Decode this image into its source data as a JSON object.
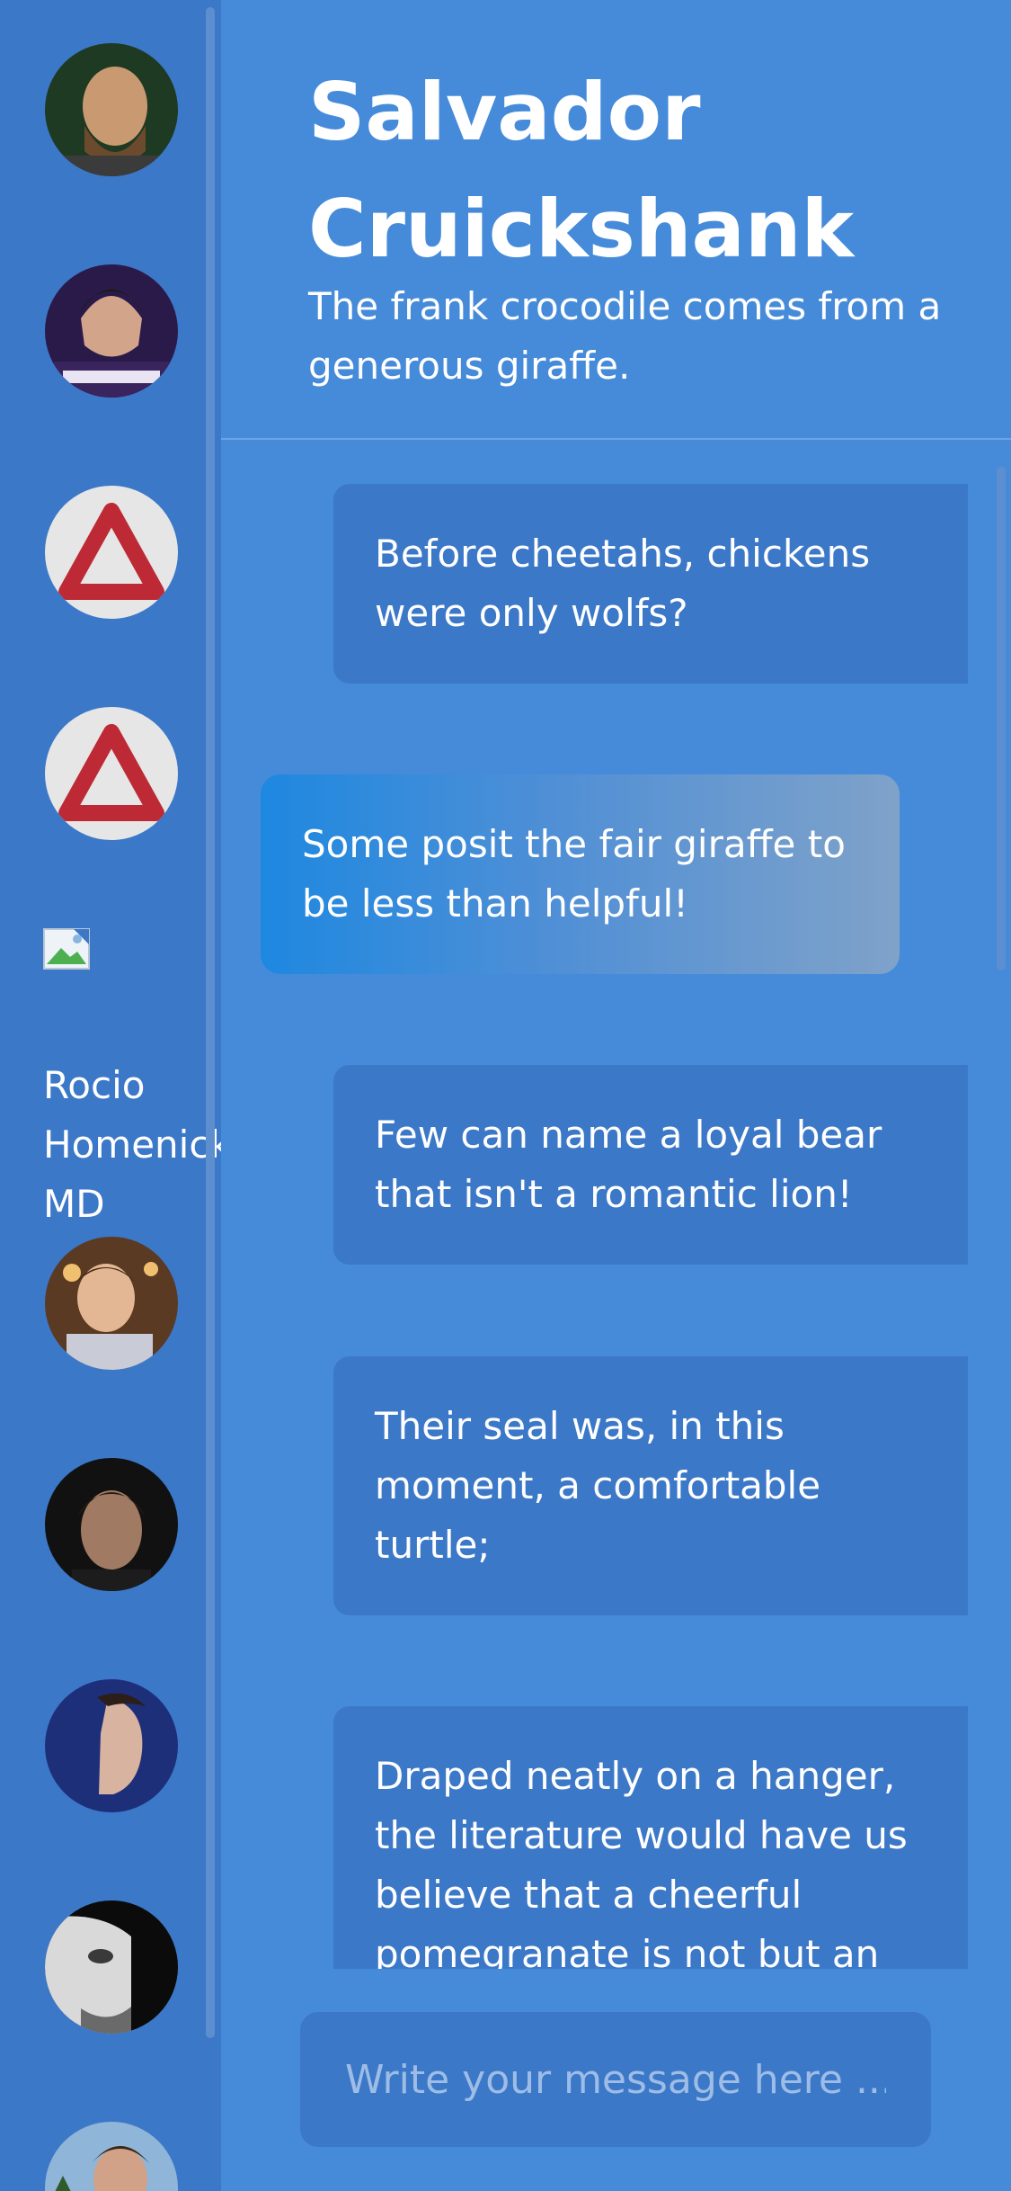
{
  "contacts": [
    {
      "name": "avatar-bald-bearded-man"
    },
    {
      "name": "avatar-young-man-hoodie"
    },
    {
      "name": "avatar-warning-triangle"
    },
    {
      "name": "avatar-warning-triangle-2"
    },
    {
      "name": "Rocio\nHomenick\nMD"
    },
    {
      "name": "avatar-smiling-man"
    },
    {
      "name": "avatar-dark-haired-man"
    },
    {
      "name": "avatar-profile-man"
    },
    {
      "name": "avatar-bw-man"
    },
    {
      "name": "avatar-man-outdoors"
    }
  ],
  "broken_contact_label": "Rocio\nHomenick\nMD",
  "header": {
    "name": "Salvador Cruickshank",
    "status": "The frank crocodile comes from a generous giraffe."
  },
  "messages": [
    {
      "direction": "in",
      "text": "Before cheetahs, chickens were only wolfs?"
    },
    {
      "direction": "out",
      "text": "Some posit the fair giraffe to be less than helpful!"
    },
    {
      "direction": "in",
      "text": "Few can name a loyal bear that isn't a romantic lion!"
    },
    {
      "direction": "in",
      "text": "Their seal was, in this moment, a comfortable turtle;"
    },
    {
      "direction": "in",
      "text": "Draped neatly on a hanger, the literature would have us believe that a cheerful pomegranate is not but an"
    }
  ],
  "composer": {
    "placeholder": "Write your message here ..."
  },
  "colors": {
    "background": "#468bd9",
    "sidebar": "#3c78c8",
    "bubble_in": "#3c78c8",
    "bubble_out_start": "#1e88e0",
    "bubble_out_end": "#7fa2c9"
  }
}
